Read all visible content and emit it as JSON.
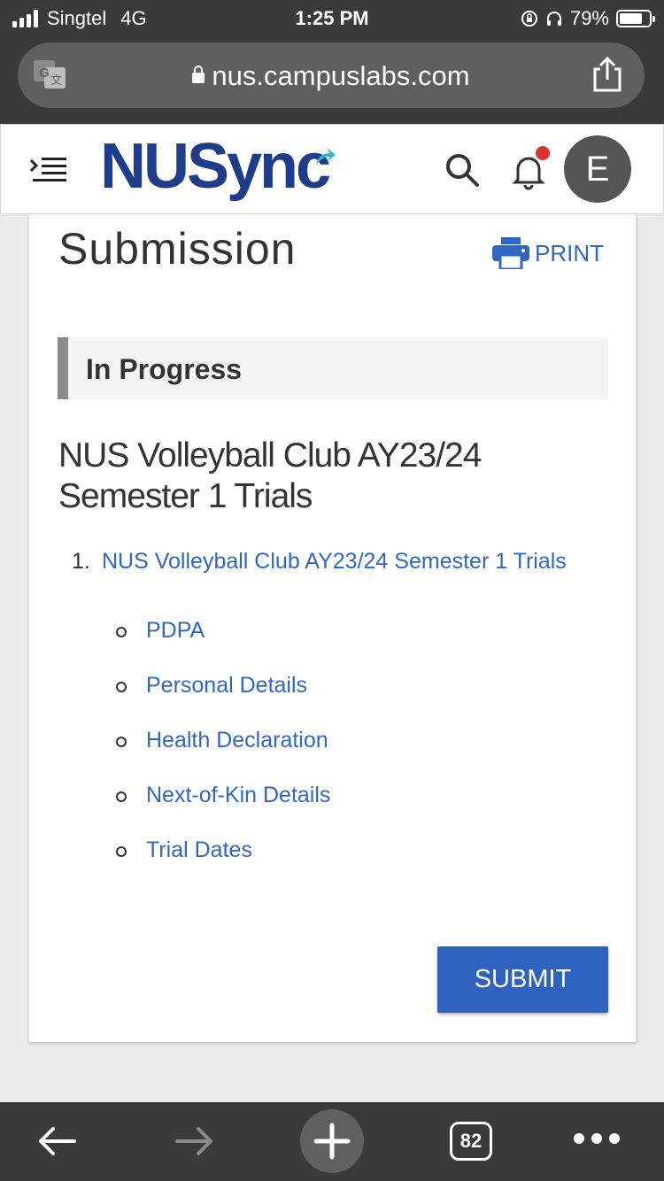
{
  "status_bar": {
    "carrier": "Singtel",
    "network": "4G",
    "time": "1:25 PM",
    "battery": "79%",
    "battery_level": 0.79
  },
  "browser": {
    "url": "nus.campuslabs.com"
  },
  "header": {
    "logo_text": "NUSync",
    "avatar_initial": "E"
  },
  "page": {
    "title": "Submission",
    "print_label": "PRINT",
    "status": "In Progress",
    "form_title": "NUS Volleyball Club AY23/24 Semester 1 Trials",
    "section_number": "1.",
    "section_link": "NUS Volleyball Club AY23/24 Semester 1 Trials",
    "subsections": [
      "PDPA",
      "Personal Details",
      "Health Declaration",
      "Next-of-Kin Details",
      "Trial Dates"
    ],
    "submit_label": "SUBMIT"
  },
  "toolbar": {
    "tab_count": "82"
  }
}
